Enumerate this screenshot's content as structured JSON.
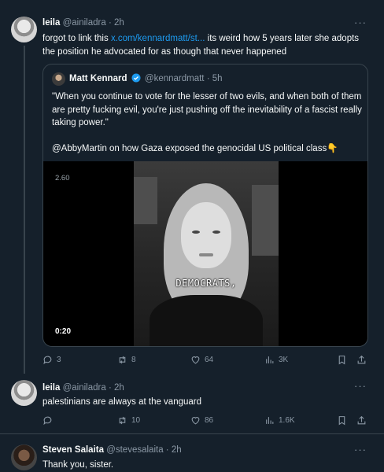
{
  "tweet1": {
    "name": "leila",
    "handle": "@ainiladra",
    "time": "2h",
    "text_before_link": "forgot to link this ",
    "link": "x.com/kennardmatt/st...",
    "text_after_link": " its weird how 5 years later she adopts the position he advocated for as though that never happened",
    "quote": {
      "name": "Matt Kennard",
      "handle": "@kennardmatt",
      "time": "5h",
      "paragraph1": "\"When you continue to vote for the lesser of two evils, and when both of them are pretty fucking evil, you're just pushing off the inevitability of a fascist really taking power.\"",
      "paragraph2": "@AbbyMartin on how Gaza exposed the genocidal US political class👇",
      "video_watermark": "2.60",
      "video_caption": "DEMOCRATS,",
      "video_time": "0:20"
    },
    "actions": {
      "replies": "3",
      "reposts": "8",
      "likes": "64",
      "views": "3K"
    }
  },
  "tweet2": {
    "name": "leila",
    "handle": "@ainiladra",
    "time": "2h",
    "text": "palestinians are always at the vanguard",
    "actions": {
      "replies": "",
      "reposts": "10",
      "likes": "86",
      "views": "1.6K"
    }
  },
  "tweet3": {
    "name": "Steven Salaita",
    "handle": "@stevesalaita",
    "time": "2h",
    "text": "Thank you, sister."
  },
  "colors": {
    "background": "#15202b",
    "accent": "#1d9bf0",
    "muted": "#8b98a5",
    "border": "#38444d"
  },
  "icons": [
    "more-icon",
    "reply-icon",
    "repost-icon",
    "like-icon",
    "views-icon",
    "bookmark-icon",
    "share-icon",
    "verified-icon"
  ]
}
